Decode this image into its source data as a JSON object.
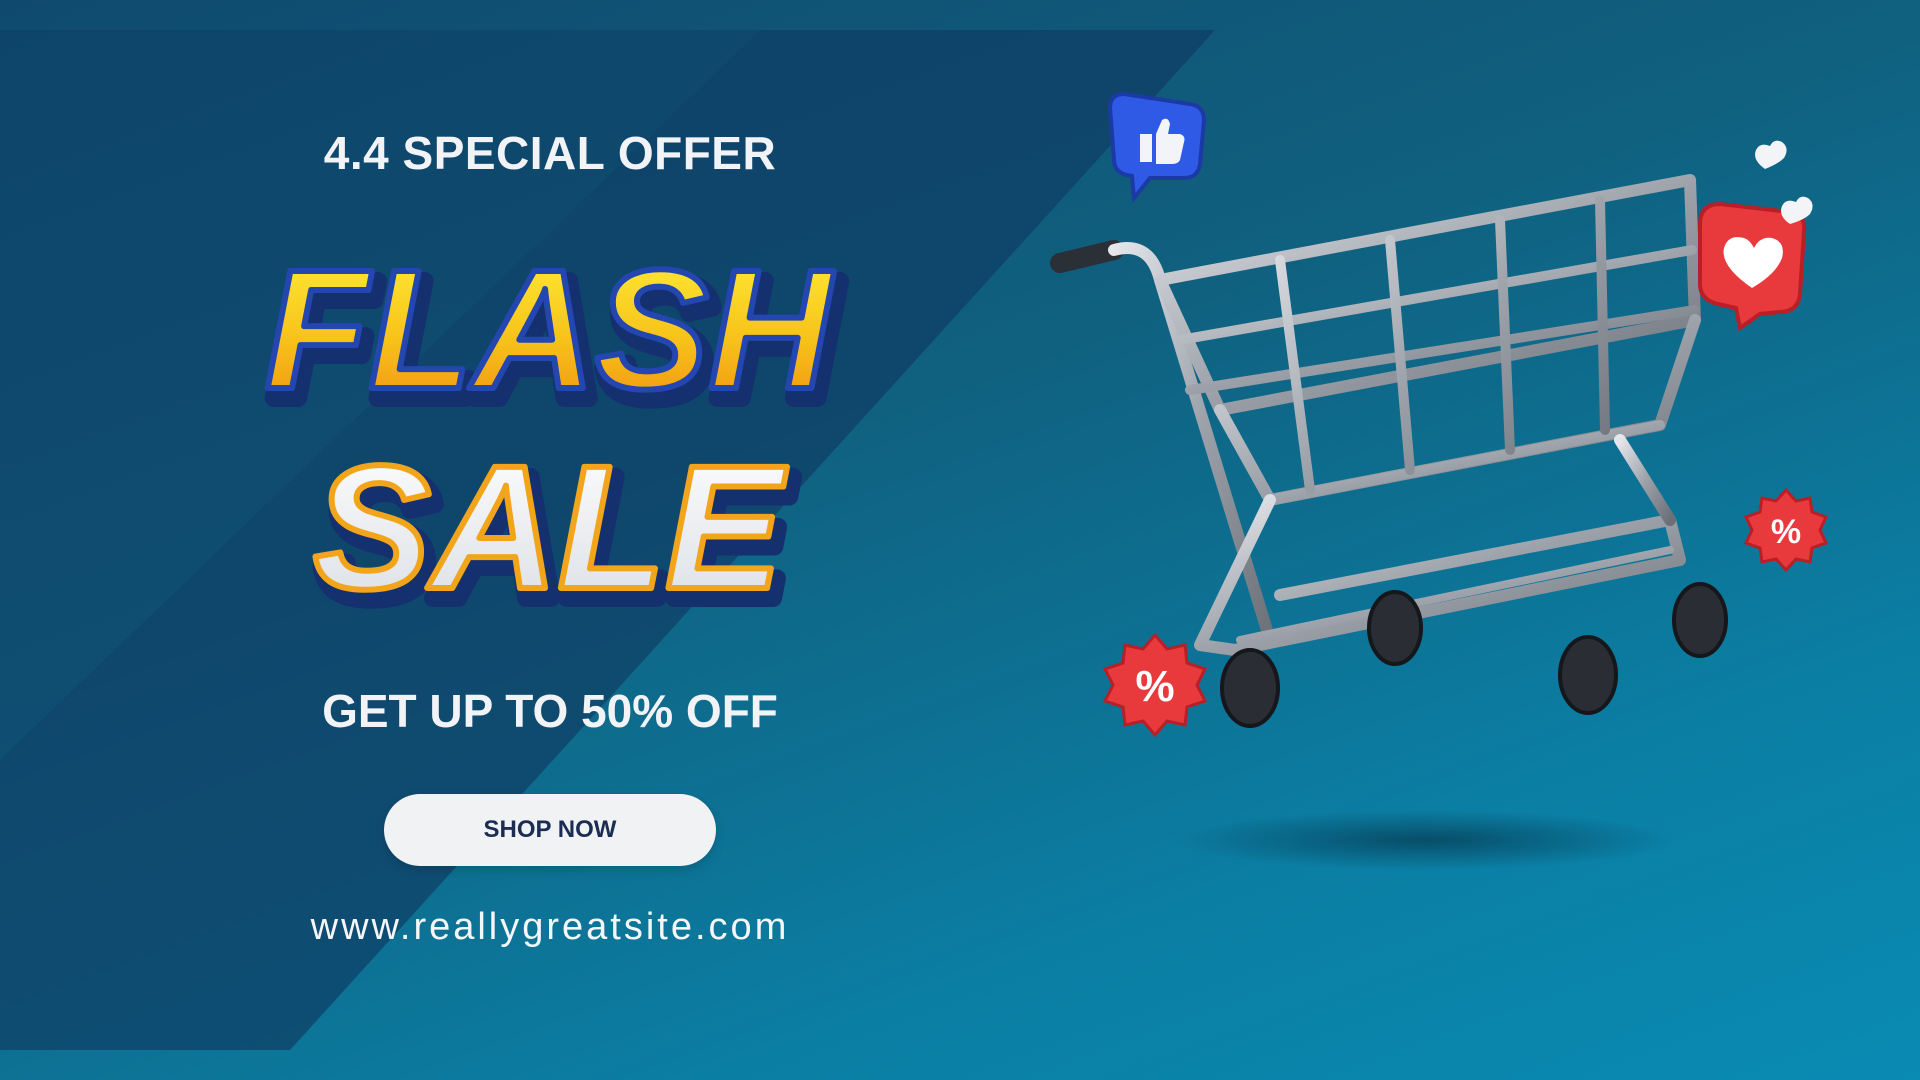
{
  "banner": {
    "eyebrow": "4.4 SPECIAL OFFER",
    "headline_line1": "FLASH",
    "headline_line2": "SALE",
    "offer": "GET UP TO 50% OFF",
    "cta_label": "SHOP NOW",
    "website": "www.reallygreatsite.com"
  },
  "colors": {
    "background_start": "#0f4a6e",
    "background_end": "#0a8bb3",
    "flash_fill": "#f7c21a",
    "flash_outline": "#1d3f9a",
    "sale_fill": "#f2f3f5",
    "sale_outline": "#f2a51a",
    "cta_bg": "#f1f2f4",
    "cta_text": "#1b2d52"
  },
  "decorations": {
    "like_icon": "thumbs-up-icon",
    "heart_icon": "heart-icon",
    "discount_icon": "percent-badge-icon",
    "cart_icon": "shopping-cart-icon"
  }
}
